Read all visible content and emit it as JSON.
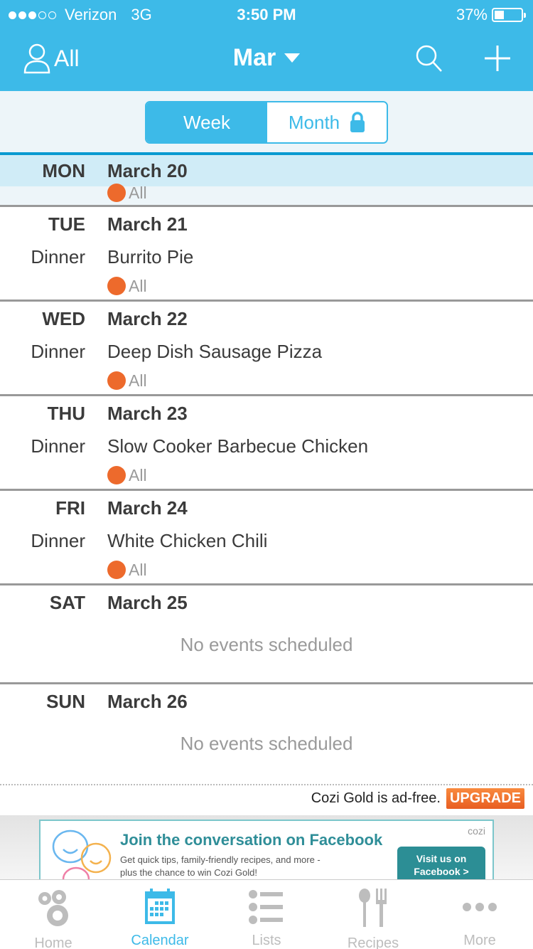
{
  "status_bar": {
    "carrier": "Verizon",
    "network": "3G",
    "signal_bars_filled": 3,
    "signal_bars_total": 5,
    "time": "3:50 PM",
    "battery_percent_label": "37%",
    "battery_level": 0.37
  },
  "header": {
    "filter_label": "All",
    "month_label": "Mar",
    "search_icon": "search-icon",
    "add_icon": "plus-icon"
  },
  "view_toggle": {
    "week_label": "Week",
    "month_label": "Month",
    "selected": "Week",
    "month_locked": true
  },
  "days": [
    {
      "dow": "MON",
      "date": "March 20",
      "today": true,
      "events": [],
      "who": "All",
      "no_events": false
    },
    {
      "dow": "TUE",
      "date": "March 21",
      "events": [
        {
          "meal": "Dinner",
          "title": "Burrito Pie",
          "who": "All"
        }
      ]
    },
    {
      "dow": "WED",
      "date": "March 22",
      "events": [
        {
          "meal": "Dinner",
          "title": "Deep Dish Sausage Pizza",
          "who": "All"
        }
      ]
    },
    {
      "dow": "THU",
      "date": "March 23",
      "events": [
        {
          "meal": "Dinner",
          "title": "Slow Cooker Barbecue Chicken",
          "who": "All"
        }
      ]
    },
    {
      "dow": "FRI",
      "date": "March 24",
      "events": [
        {
          "meal": "Dinner",
          "title": "White Chicken Chili",
          "who": "All"
        }
      ]
    },
    {
      "dow": "SAT",
      "date": "March 25",
      "events": [],
      "empty_text": "No events scheduled"
    },
    {
      "dow": "SUN",
      "date": "March 26",
      "events": [],
      "empty_text": "No events scheduled"
    }
  ],
  "colors": {
    "brand": "#3dbae8",
    "member_all": "#ed6a2c",
    "upgrade": "#e85e22"
  },
  "promo": {
    "text": "Cozi Gold is ad-free.",
    "button": "UPGRADE"
  },
  "ad": {
    "title": "Join the conversation on Facebook",
    "line1": "Get quick tips, family-friendly recipes, and more -",
    "line2": "plus the chance to win Cozi Gold!",
    "logo": "cozi",
    "cta_line1": "Visit us on",
    "cta_line2": "Facebook >"
  },
  "tabs": [
    {
      "label": "Home",
      "icon": "home-icon",
      "active": false
    },
    {
      "label": "Calendar",
      "icon": "calendar-icon",
      "active": true
    },
    {
      "label": "Lists",
      "icon": "list-icon",
      "active": false
    },
    {
      "label": "Recipes",
      "icon": "recipes-icon",
      "active": false
    },
    {
      "label": "More",
      "icon": "more-icon",
      "active": false
    }
  ]
}
